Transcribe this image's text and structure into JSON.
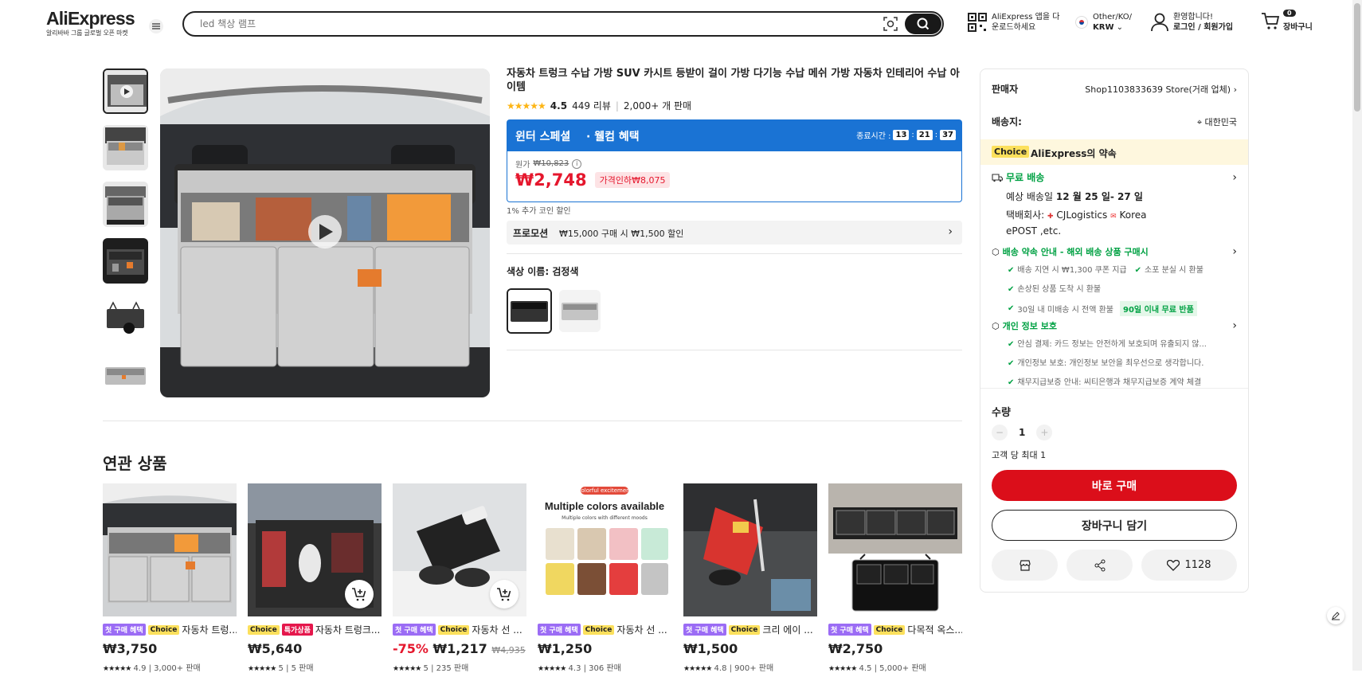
{
  "header": {
    "logo_main": "AliExpress",
    "logo_sub": "알리바바 그룹 글로벌 오픈 마켓",
    "search_placeholder": "led 책상 램프",
    "app_download": [
      "AliExpress 앱을 다",
      "운로드하세요"
    ],
    "locale_top": "Other/KO/",
    "locale_currency": "KRW",
    "welcome": "환영합니다!",
    "login": "로그인 / 회원가입",
    "cart_count": "0",
    "cart_label": "장바구니"
  },
  "product": {
    "title": "자동차 트렁크 수납 가방 SUV 카시트 등받이 걸이 가방 다기능 수납 메쉬 가방 자동차 인테리어 수납 아이템",
    "rating": "4.5",
    "reviews": "449 리뷰",
    "sold": "2,000+ 개 판매",
    "banner_title": "윈터 스페셜",
    "banner_sub": "· 웰컴 혜택",
    "countdown_label": "종료시간 :",
    "countdown": [
      "13",
      "21",
      "37"
    ],
    "original_label": "원가",
    "original_price": "₩10,823",
    "price": "₩2,748",
    "discount_tag": "가격인하₩8,075",
    "coin_note": "1% 추가 코인 할인",
    "promo_label": "프로모션",
    "promo_text": "₩15,000 구매 시 ₩1,500 할인",
    "color_label": "색상 이름: 검정색"
  },
  "sidebar": {
    "seller_label": "판매자",
    "seller_name": "Shop1103833639 Store(거래 업체)",
    "ship_label": "배송지:",
    "ship_dest": "대한민국",
    "choice_badge": "Choice",
    "choice_promise": "AliExpress의 약속",
    "free_ship": "무료 배송",
    "delivery_est_prefix": "예상 배송일 ",
    "delivery_est": "12 월 25 일- 27 일",
    "carrier_label": "택배회사:",
    "carrier_1": "CJLogistics",
    "carrier_2": "Korea",
    "carrier_3": "ePOST ,etc.",
    "promise_title": "배송 약속 안내 - 해외 배송 상품 구매시",
    "promise_items": [
      "배송 지연 시 ₩1,300 쿠폰 지급",
      "소포 분실 시 환불",
      "손상된 상품 도착 시 환불",
      "30일 내 미배송 시 전액 환불"
    ],
    "promise_badge": "90일 이내 무료 반품",
    "privacy_title": "개인 정보 보호",
    "privacy_items": [
      "안심 결제: 카드 정보는 안전하게 보호되며 유출되지 않...",
      "개인정보 보호: 개인정보 보안을 최우선으로 생각합니다.",
      "채무지급보증 안내: 씨티은행과 채무지급보증 계약 체결"
    ],
    "qty_label": "수량",
    "qty_value": "1",
    "qty_limit": "고객 당 최대 1",
    "buy_now": "바로 구매",
    "add_cart": "장바구니 담기",
    "wishlist_count": "1128"
  },
  "related": {
    "heading": "연관 상품",
    "items": [
      {
        "badges": [
          "첫 구매 혜택",
          "Choice"
        ],
        "name": "자동차 트렁...",
        "discount": "",
        "price": "₩3,750",
        "orig": "",
        "stars": "★★★★★",
        "meta": "4.9 | 3,000+ 판매"
      },
      {
        "badges": [
          "Choice",
          "특가상품"
        ],
        "name": "자동차 트렁크...",
        "discount": "",
        "price": "₩5,640",
        "orig": "",
        "stars": "★★★★★",
        "meta": "5 | 5 판매"
      },
      {
        "badges": [
          "첫 구매 혜택",
          "Choice"
        ],
        "name": "자동차 선 ...",
        "discount": "-75%",
        "price": "₩1,217",
        "orig": "₩4,935",
        "stars": "★★★★★",
        "meta": "5 | 235 판매"
      },
      {
        "badges": [
          "첫 구매 혜택",
          "Choice"
        ],
        "name": "자동차 선 ...",
        "discount": "",
        "price": "₩1,250",
        "orig": "",
        "stars": "★★★★★",
        "meta": "4.3 | 306 판매"
      },
      {
        "badges": [
          "첫 구매 혜택",
          "Choice"
        ],
        "name": "크리 에이 ...",
        "discount": "",
        "price": "₩1,500",
        "orig": "",
        "stars": "★★★★★",
        "meta": "4.8 | 900+ 판매"
      },
      {
        "badges": [
          "첫 구매 혜택",
          "Choice"
        ],
        "name": "다목적 옥스...",
        "discount": "",
        "price": "₩2,750",
        "orig": "",
        "stars": "★★★★★",
        "meta": "4.5 | 5,000+ 판매"
      }
    ],
    "img_texts": {
      "tag": "Colorful excitement",
      "headline": "Multiple colors available",
      "sub": "Multiple colors with different moods"
    }
  }
}
